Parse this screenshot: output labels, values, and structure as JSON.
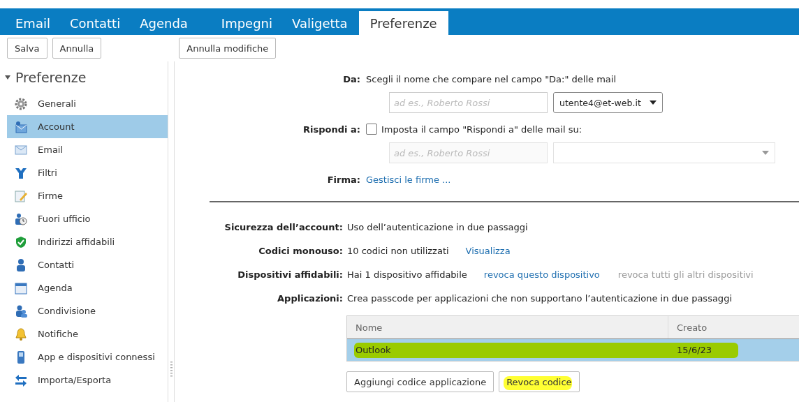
{
  "tabs": [
    {
      "label": "Email",
      "selected": false
    },
    {
      "label": "Contatti",
      "selected": false
    },
    {
      "label": "Agenda",
      "selected": false
    },
    {
      "label": "Impegni",
      "selected": false
    },
    {
      "label": "Valigetta",
      "selected": false
    },
    {
      "label": "Preferenze",
      "selected": true
    }
  ],
  "toolbar": {
    "left_buttons": [
      "Salva",
      "Annulla"
    ],
    "right_buttons": [
      "Annulla modifiche"
    ]
  },
  "sidebar": {
    "title": "Preferenze",
    "expanded": true,
    "items": [
      {
        "label": "Generali",
        "selected": false
      },
      {
        "label": "Account",
        "selected": true
      },
      {
        "label": "Email",
        "selected": false
      },
      {
        "label": "Filtri",
        "selected": false
      },
      {
        "label": "Firme",
        "selected": false
      },
      {
        "label": "Fuori ufficio",
        "selected": false
      },
      {
        "label": "Indirizzi affidabili",
        "selected": false
      },
      {
        "label": "Contatti",
        "selected": false
      },
      {
        "label": "Agenda",
        "selected": false
      },
      {
        "label": "Condivisione",
        "selected": false
      },
      {
        "label": "Notifiche",
        "selected": false
      },
      {
        "label": "App e dispositivi connessi",
        "selected": false
      },
      {
        "label": "Importa/Esporta",
        "selected": false
      }
    ]
  },
  "sent_settings": {
    "from": {
      "label": "Da:",
      "text": "Scegli il nome che compare nel campo \"Da:\" delle mail",
      "name_placeholder": "ad es., Roberto Rossi",
      "address": "utente4@et-web.it"
    },
    "reply_to": {
      "label": "Rispondi a:",
      "checked": false,
      "text": "Imposta il campo \"Rispondi a\" delle mail su:",
      "name_placeholder": "ad es., Roberto Rossi"
    },
    "signature": {
      "label": "Firma:",
      "link": "Gestisci le firme ..."
    }
  },
  "security": [
    {
      "label": "Sicurezza dell’account:",
      "text": "Uso dell’autenticazione in due passaggi"
    },
    {
      "label": "Codici monouso:",
      "text": "10 codici non utilizzati",
      "links": [
        {
          "text": "Visualizza",
          "disabled": false
        }
      ]
    },
    {
      "label": "Dispositivi affidabili:",
      "text": "Hai 1 dispositivo affidabile",
      "links": [
        {
          "text": "revoca questo dispositivo",
          "disabled": false
        },
        {
          "text": "revoca tutti gli altri dispositivi",
          "disabled": true
        }
      ]
    },
    {
      "label": "Applicazioni:",
      "text": "Crea passcode per applicazioni che non supportano l’autenticazione in due passaggi"
    }
  ],
  "app_table": {
    "columns": [
      "Nome",
      "Creato"
    ],
    "rows": [
      {
        "cells": [
          "Outlook",
          "15/6/23"
        ],
        "selected": true,
        "highlighted": true
      }
    ]
  },
  "app_buttons": [
    {
      "label": "Aggiungi codice applicazione",
      "highlighted": false
    },
    {
      "label": "Revoca codice",
      "highlighted": true
    }
  ]
}
